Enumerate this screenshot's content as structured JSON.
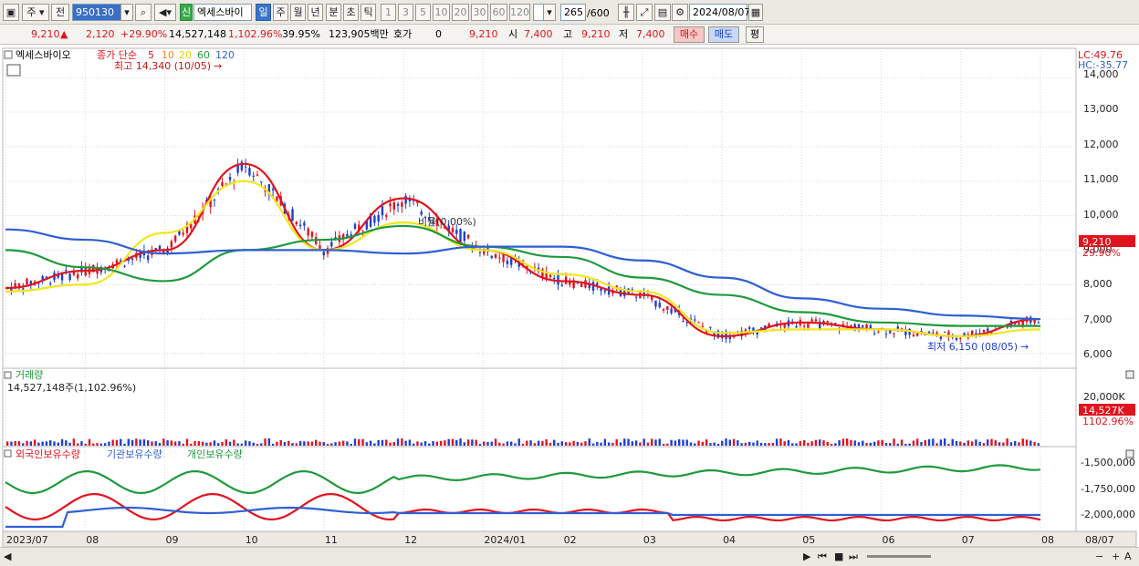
{
  "toolbar": {
    "period": "주",
    "type": "전",
    "code": "950130",
    "new_badge": "신",
    "stock_name": "엑세스바이",
    "timeframes": [
      "일",
      "주",
      "월",
      "년",
      "분",
      "초",
      "틱"
    ],
    "intervals": [
      "1",
      "3",
      "5",
      "10",
      "20",
      "30",
      "60",
      "120"
    ],
    "count": "265",
    "count_max": "/600",
    "date": "2024/08/07"
  },
  "quote": {
    "price": "9,210",
    "change": "2,120",
    "change_pct": "+29.90%",
    "volume": "14,527,148",
    "volume_pct": "1,102.96%",
    "turnover": "39.95%",
    "amount": "123,905백만",
    "hoga_label": "호가",
    "hoga_value": "0",
    "current": "9,210",
    "open_label": "시",
    "open": "7,400",
    "high_label": "고",
    "high": "9,210",
    "low_label": "저",
    "low": "7,400",
    "buy_label": "매수",
    "sell_label": "매도",
    "eval_label": "평"
  },
  "chart_data": {
    "type": "line",
    "price_panel": {
      "name": "엑세스바이오",
      "ma_title": "종가 단순",
      "ma_periods": [
        {
          "label": "5",
          "color": "#e0141e"
        },
        {
          "label": "10",
          "color": "#f08c1e"
        },
        {
          "label": "20",
          "color": "#f0e61e"
        },
        {
          "label": "60",
          "color": "#1e9a3c"
        },
        {
          "label": "120",
          "color": "#2f5fd2"
        }
      ],
      "high_note": "최고 14,340 (10/05)",
      "low_note": "최저 6,150 (08/05)",
      "ratio_note": "비율(0.00%)",
      "lc_label": "LC:49.76",
      "hc_label": "HC:-35.77",
      "y_ticks": [
        "14,000",
        "13,000",
        "12,000",
        "11,000",
        "10,000",
        "9,000",
        "8,000",
        "7,000",
        "6,000"
      ],
      "ylim": [
        5600,
        14800
      ],
      "last_price_tag": "9,210",
      "last_pct_tag": "29.90%"
    },
    "volume_panel": {
      "title": "거래량",
      "value_text": "14,527,148주(1,102.96%)",
      "y_ticks": [
        "20,000K"
      ],
      "last_tag": "14,527K",
      "last_pct": "1102.96%"
    },
    "holding_panel": {
      "series_names": [
        "외국인보유수량",
        "기관보유수량",
        "개인보유수량"
      ],
      "colors": [
        "#e0141e",
        "#2f5fd2",
        "#1e9a3c"
      ],
      "y_ticks": [
        "-1,500,000",
        "-1,750,000",
        "-2,000,000"
      ]
    },
    "x_labels": [
      "2023/07",
      "08",
      "09",
      "10",
      "11",
      "12",
      "2024/01",
      "02",
      "03",
      "04",
      "05",
      "06",
      "07",
      "08",
      "08/07"
    ],
    "ma_series": [
      {
        "name": "5",
        "x": [
          "2023/07",
          "08",
          "09",
          "10",
          "11",
          "12",
          "2024/01",
          "02",
          "03",
          "04",
          "05",
          "06",
          "07",
          "08"
        ],
        "values": [
          7900,
          8400,
          9000,
          11500,
          9000,
          10500,
          9000,
          8100,
          7700,
          6500,
          6900,
          6700,
          6500,
          7000
        ]
      },
      {
        "name": "20",
        "x": [
          "2023/07",
          "08",
          "09",
          "10",
          "11",
          "12",
          "2024/01",
          "02",
          "03",
          "04",
          "05",
          "06",
          "07",
          "08"
        ],
        "values": [
          7800,
          8000,
          9500,
          11000,
          9000,
          9800,
          9000,
          8300,
          7800,
          6600,
          6700,
          6700,
          6500,
          6700
        ]
      },
      {
        "name": "60",
        "x": [
          "2023/07",
          "08",
          "09",
          "10",
          "11",
          "12",
          "2024/01",
          "02",
          "03",
          "04",
          "05",
          "06",
          "07",
          "08"
        ],
        "values": [
          9000,
          8500,
          8100,
          9000,
          9300,
          9700,
          9100,
          8800,
          8200,
          7700,
          7200,
          6900,
          6800,
          6800
        ]
      },
      {
        "name": "120",
        "x": [
          "2023/07",
          "08",
          "09",
          "10",
          "11",
          "12",
          "2024/01",
          "02",
          "03",
          "04",
          "05",
          "06",
          "07",
          "08"
        ],
        "values": [
          9600,
          9300,
          8900,
          9000,
          9000,
          8900,
          9100,
          9100,
          8700,
          8200,
          7600,
          7300,
          7100,
          7000
        ]
      }
    ]
  }
}
